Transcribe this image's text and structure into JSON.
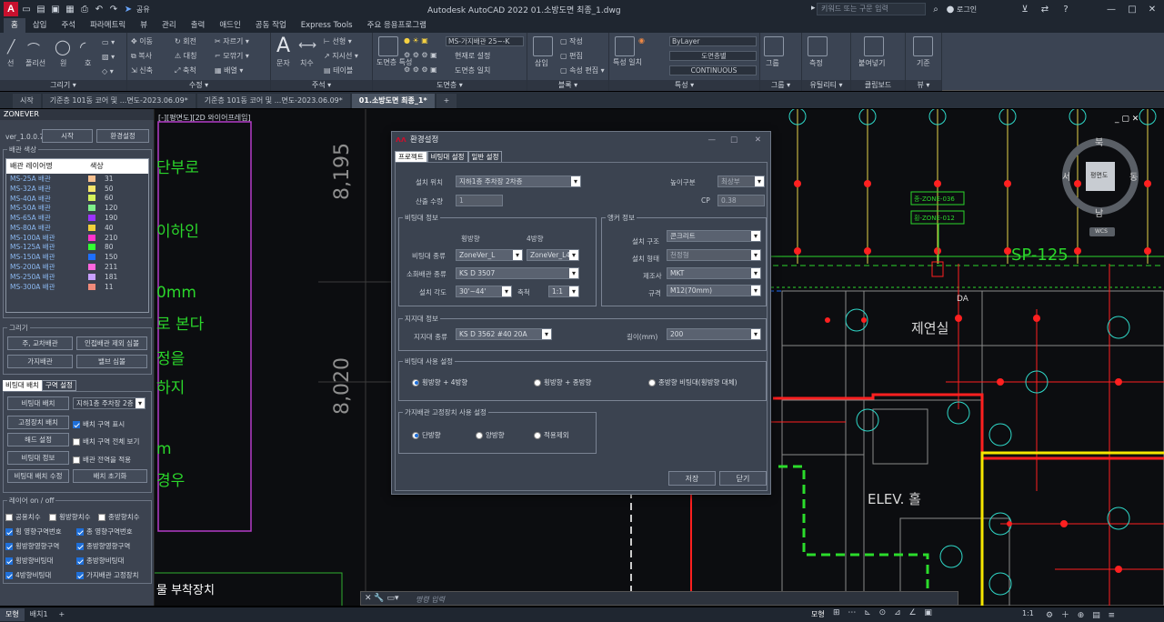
{
  "app": {
    "title": "Autodesk AutoCAD 2022    01.소방도면 최종_1.dwg",
    "search_placeholder": "키워드 또는 구문 입력",
    "login": "로그인",
    "share": "공유"
  },
  "ribbon": {
    "tabs": [
      "홈",
      "삽입",
      "주석",
      "파라메트릭",
      "뷰",
      "관리",
      "출력",
      "애드인",
      "공동 작업",
      "Express Tools",
      "주요 응용프로그램"
    ],
    "panels": {
      "draw": "그리기 ▾",
      "modify": "수정 ▾",
      "annotation": "주석 ▾",
      "layers": "도면층 ▾",
      "block": "블록 ▾",
      "properties": "특성 ▾",
      "groups": "그룹 ▾",
      "utilities": "유틸리티 ▾",
      "clipboard": "클립보드",
      "view": "뷰 ▾"
    },
    "tools": {
      "line": "선",
      "polyline": "폴리선",
      "circle": "원",
      "arc": "호",
      "move": "이동",
      "rotate": "회전",
      "trim": "자르기",
      "copy": "복사",
      "mirror": "대칭",
      "fillet": "모깎기",
      "stretch": "신축",
      "scale": "축척",
      "array": "배열",
      "text": "문자",
      "dimension": "치수",
      "leader": "지시선",
      "table": "테이블",
      "linear": "선형",
      "layer_props": "도면층 특성",
      "layer_combo": "MS-가지배관 25~-K",
      "make_current": "현재로 설정",
      "match_layer": "도면층 일치",
      "insert": "삽입",
      "create": "작성",
      "edit": "편집",
      "edit_attr": "속성 편집",
      "match_props": "특성 일치",
      "bylayer": "ByLayer",
      "lineweight": "도면층별",
      "linetype": "CONTINUOUS",
      "group": "그룹",
      "measure": "측정",
      "paste": "붙여넣기",
      "base": "기준"
    }
  },
  "doc_tabs": [
    "시작",
    "기준층 101동 코어 및 ...면도-2023.06.09*",
    "기준층 101동 코어 및 ...면도-2023.06.09*",
    "01.소방도면 최종_1*"
  ],
  "palette": {
    "title": "ZONEVER",
    "version": "ver_1.0.0.7",
    "start_btn": "시작",
    "settings_btn": "환경설정",
    "pipe_color_label": "배관 색상",
    "table_headers": [
      "배관 레이어명",
      "색상"
    ],
    "layers": [
      {
        "name": "MS-25A 배관",
        "color": "#f7c08f",
        "value": "31"
      },
      {
        "name": "MS-32A 배관",
        "color": "#f5e56b",
        "value": "50"
      },
      {
        "name": "MS-40A 배관",
        "color": "#d4f25a",
        "value": "60"
      },
      {
        "name": "MS-50A 배관",
        "color": "#7ef08a",
        "value": "120"
      },
      {
        "name": "MS-65A 배관",
        "color": "#9b33ff",
        "value": "190"
      },
      {
        "name": "MS-80A 배관",
        "color": "#f0d23a",
        "value": "40"
      },
      {
        "name": "MS-100A 배관",
        "color": "#ff33cc",
        "value": "210"
      },
      {
        "name": "MS-125A 배관",
        "color": "#33ff33",
        "value": "80"
      },
      {
        "name": "MS-150A 배관",
        "color": "#1e6fff",
        "value": "150"
      },
      {
        "name": "MS-200A 배관",
        "color": "#ff66dd",
        "value": "211"
      },
      {
        "name": "MS-250A 배관",
        "color": "#c8a0ff",
        "value": "181"
      },
      {
        "name": "MS-300A 배관",
        "color": "#f08a7a",
        "value": "11"
      }
    ],
    "draw_label": "그리기",
    "draw_buttons": [
      "주, 교차배관",
      "인접배관 제외 심볼",
      "가지배관",
      "밸브 심볼"
    ],
    "sub_tabs": [
      "비팅대 배치",
      "구역 설정"
    ],
    "place_btn": "비팅대 배치",
    "place_combo": "지하1층 주차장 2층",
    "fixed_btn": "고정장치 배치",
    "show_zone": "배치 구역 표시",
    "edit_btn": "해드 설정",
    "show_all": "배치 구역 전체 보기",
    "info_btn": "비팅대 정보",
    "apply_all": "배관 전역을 적용",
    "modify_btn": "비팅대 배치 수정",
    "reset_btn": "배치 초기화",
    "layer_onoff": "레이어 on / off",
    "layer_checks": [
      {
        "label": "공용치수",
        "on": false
      },
      {
        "label": "횡방향치수",
        "on": false
      },
      {
        "label": "종방향치수",
        "on": false
      },
      {
        "label": "횡 영향구역번호",
        "on": true
      },
      {
        "label": "종 영향구역번호",
        "on": true
      },
      {
        "label": "횡방향영향구역",
        "on": true
      },
      {
        "label": "종방향영향구역",
        "on": true
      },
      {
        "label": "횡방향비팅대",
        "on": true
      },
      {
        "label": "종방향비팅대",
        "on": true
      },
      {
        "label": "4방향비팅대",
        "on": true
      },
      {
        "label": "가지배관 고정장치",
        "on": true
      }
    ]
  },
  "drawing": {
    "view_label": "[-][평면도][2D 와이어프레임]",
    "texts": [
      "단부로",
      "이하인",
      "0mm",
      "로 본다",
      "정을",
      "하지",
      "m",
      "경우",
      "물 부착장치"
    ],
    "dims": [
      "8,195",
      "8,020"
    ],
    "room1": "제연실",
    "room2": "ELEV. 홀",
    "sp": "SP-125",
    "zone1": "종-ZONE-036",
    "zone2": "횡-ZONE-012",
    "da": "DA",
    "compass": {
      "n": "북",
      "s": "남",
      "w": "서",
      "e": "동",
      "center": "평면도"
    },
    "wcs": "WCS"
  },
  "dialog": {
    "title": "환경설정",
    "tabs": [
      "프로젝트",
      "비팅대 설정",
      "일반 설정"
    ],
    "install_pos_label": "설치 위치",
    "install_pos": "지하1층 주차장 2차층",
    "height_label": "높이구분",
    "height_val": "최상부",
    "quake_label": "산출 수량",
    "quake_val": "1",
    "cp_label": "CP",
    "cp_val": "0.38",
    "brace_info": "비팅대 정보",
    "col_h": "횡방향",
    "col_4": "4방향",
    "brace_type_label": "비팅대 종류",
    "brace_type_h": "ZoneVer_L",
    "brace_type_4": "ZoneVer_L4",
    "pipe_type_label": "소화배관 종류",
    "pipe_type": "KS D 3507",
    "angle_label": "설치 각도",
    "angle_val": "30'~44'",
    "ratio_label": "축척",
    "ratio_val": "1:1",
    "anchor_info": "앵커 정보",
    "structure_label": "설치 구조",
    "structure_val": "콘크리트",
    "form_label": "설치 형태",
    "form_val": "천정형",
    "maker_label": "제조사",
    "maker_val": "MKT",
    "spec_label": "규격",
    "spec_val": "M12(70mm)",
    "hanger_info": "지지대 정보",
    "hanger_type_label": "지지대 종류",
    "hanger_type_val": "KS D 3562 #40 20A",
    "length_label": "길이(mm)",
    "length_val": "200",
    "usage_label": "비팅대 사용 설정",
    "usage_opts": [
      "횡방향 + 4방향",
      "횡방향 + 종방향",
      "종방향 비팅대(횡방향 대체)"
    ],
    "branch_label": "가지배관 고정장치 사용 설정",
    "branch_opts": [
      "단방향",
      "양방향",
      "적용제외"
    ],
    "save_btn": "저장",
    "close_btn": "닫기"
  },
  "cmd": {
    "placeholder": "명령 입력"
  },
  "status": {
    "tabs": [
      "모형",
      "배치1"
    ],
    "model": "모형",
    "scale": "1:1"
  }
}
